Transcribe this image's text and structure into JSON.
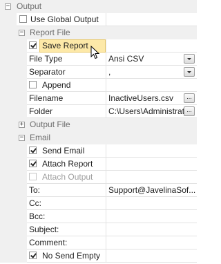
{
  "output": {
    "title": "Output",
    "use_global_output": {
      "label": "Use Global Output",
      "checked": false
    }
  },
  "report_file": {
    "title": "Report File",
    "save_report": {
      "label": "Save Report",
      "checked": true
    },
    "file_type": {
      "label": "File Type",
      "value": "Ansi CSV"
    },
    "separator": {
      "label": "Separator",
      "value": ","
    },
    "append": {
      "label": "Append",
      "checked": false
    },
    "filename": {
      "label": "Filename",
      "value": "InactiveUsers.csv",
      "button": "..."
    },
    "folder": {
      "label": "Folder",
      "value": "C:\\Users\\Administrat",
      "button": "..."
    }
  },
  "output_file": {
    "title": "Output File",
    "toggle": "+"
  },
  "email": {
    "title": "Email",
    "send_email": {
      "label": "Send Email",
      "checked": true
    },
    "attach_report": {
      "label": "Attach Report",
      "checked": true
    },
    "attach_output": {
      "label": "Attach Output",
      "checked": false
    },
    "to": {
      "label": "To:",
      "value": "Support@JavelinaSof..."
    },
    "cc": {
      "label": "Cc:",
      "value": ""
    },
    "bcc": {
      "label": "Bcc:",
      "value": ""
    },
    "subject": {
      "label": "Subject:",
      "value": ""
    },
    "comment": {
      "label": "Comment:",
      "value": ""
    },
    "no_send_empty": {
      "label": "No Send Empty",
      "checked": true
    }
  },
  "toggles": {
    "expanded": "−",
    "collapsed": "+"
  },
  "colors": {
    "category_band": "#f0f0f0",
    "highlight": "#fde9a8",
    "disabled_text": "#9f9f9f"
  }
}
